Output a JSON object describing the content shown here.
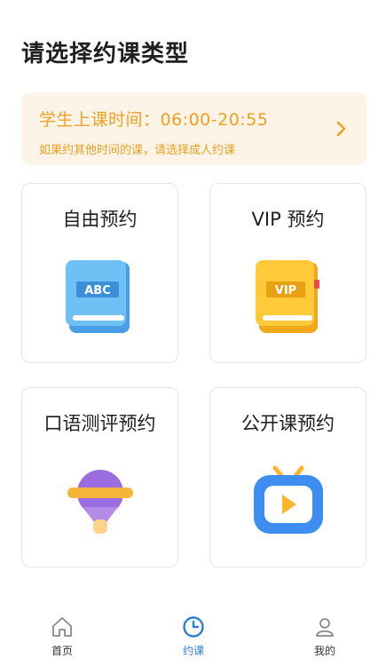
{
  "page": {
    "title": "请选择约课类型"
  },
  "banner": {
    "title": "学生上课时间：06:00-20:55",
    "subtitle": "如果约其他时间的课，请选择成人约课",
    "icon": "chevron-right-icon"
  },
  "cards": [
    {
      "label": "自由预约",
      "icon": "abc-book-icon"
    },
    {
      "label": "VIP 预约",
      "icon": "vip-book-icon"
    },
    {
      "label": "口语测评预约",
      "icon": "microphone-icon"
    },
    {
      "label": "公开课预约",
      "icon": "tv-play-icon"
    }
  ],
  "tabbar": {
    "items": [
      {
        "label": "首页",
        "icon": "home-icon",
        "active": false
      },
      {
        "label": "约课",
        "icon": "clock-icon",
        "active": true
      },
      {
        "label": "我的",
        "icon": "user-icon",
        "active": false
      }
    ]
  },
  "colors": {
    "accent_orange": "#f0a020",
    "banner_bg": "#fdf4e7",
    "active_tab": "#2a7fd8"
  }
}
